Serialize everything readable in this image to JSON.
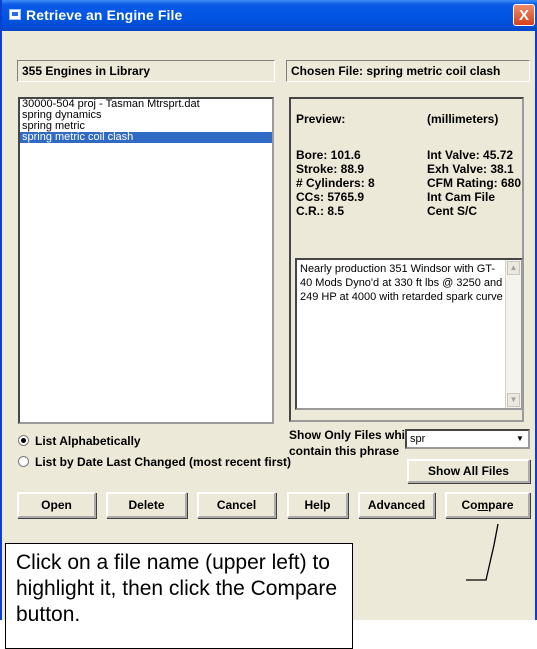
{
  "window": {
    "title": "Retrieve an Engine File",
    "close_label": "X"
  },
  "library": {
    "header": "355 Engines in Library",
    "files": [
      "30000-504 proj - Tasman Mtrsprt.dat",
      "spring dynamics",
      "spring metric",
      "spring metric coil clash"
    ],
    "selected_index": 3
  },
  "chosen": {
    "header": "Chosen File: spring metric coil clash"
  },
  "preview": {
    "label": "Preview:",
    "units": "(millimeters)",
    "left": [
      "Bore:  101.6",
      "Stroke:  88.9",
      "# Cylinders:  8",
      "CCs: 5765.9",
      "C.R.: 8.5"
    ],
    "right": [
      "Int Valve: 45.72",
      "Exh Valve: 38.1",
      "CFM Rating: 680",
      "Int Cam File",
      "Cent S/C"
    ],
    "notes": "Nearly production 351 Windsor with GT-40 Mods Dyno'd at 330 ft lbs @ 3250 and 249 HP at 4000 with retarded spark curve"
  },
  "sort": {
    "alpha_label": "List Alphabetically",
    "date_label": "List by Date Last Changed (most recent first)"
  },
  "filter": {
    "label_line1": "Show Only Files which",
    "label_line2": "contain this phrase",
    "value": "spr",
    "show_all_label": "Show All Files"
  },
  "buttons": {
    "open": "Open",
    "delete": "Delete",
    "cancel": "Cancel",
    "help": "Help",
    "advanced": "Advanced",
    "compare_prefix": "Co",
    "compare_u": "m",
    "compare_suffix": "pare"
  },
  "callout": {
    "text": "Click on a file name (upper left) to highlight it, then click the Compare button."
  }
}
